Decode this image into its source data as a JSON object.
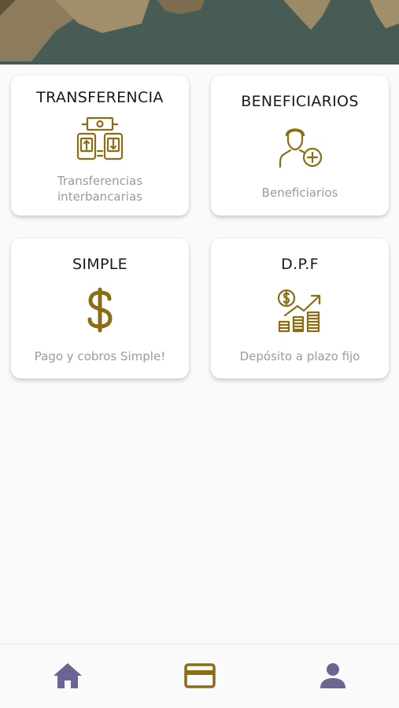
{
  "colors": {
    "accent": "#8a6d15",
    "nav_inactive": "#6b6594",
    "nav_active": "#8a6d15",
    "banner": "#465c54"
  },
  "cards": [
    {
      "title": "TRANSFERENCIA",
      "subtitle_line1": "Transferencias",
      "subtitle_line2": "interbancarias",
      "icon": "bank-transfer-icon"
    },
    {
      "title": "BENEFICIARIOS",
      "subtitle": "Beneficiarios",
      "icon": "add-user-icon"
    },
    {
      "title": "SIMPLE",
      "subtitle": "Pago y cobros Simple!",
      "icon": "dollar-icon"
    },
    {
      "title": "D.P.F",
      "subtitle": "Depósito a plazo fijo",
      "icon": "investment-growth-icon"
    }
  ],
  "bottom_nav": [
    {
      "icon": "home-icon",
      "active": false
    },
    {
      "icon": "credit-card-icon",
      "active": true
    },
    {
      "icon": "profile-icon",
      "active": false
    }
  ]
}
